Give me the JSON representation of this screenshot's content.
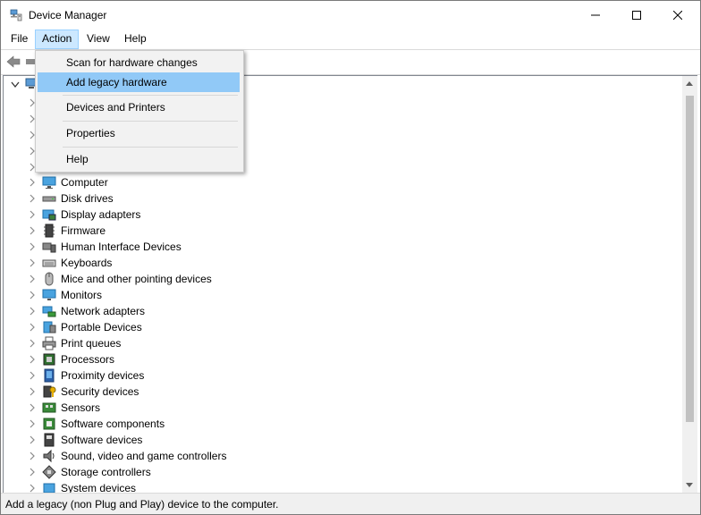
{
  "window": {
    "title": "Device Manager",
    "app_icon": "device-manager-icon"
  },
  "caption": {
    "minimize_icon": "minimize-icon",
    "maximize_icon": "maximize-icon",
    "close_icon": "close-icon"
  },
  "menu": {
    "file": "File",
    "action": "Action",
    "view": "View",
    "help": "Help"
  },
  "dropdown": {
    "items": [
      {
        "label": "Scan for hardware changes"
      },
      {
        "label": "Add legacy hardware",
        "highlighted": true
      },
      {
        "label": "Devices and Printers"
      },
      {
        "label": "Properties"
      },
      {
        "label": "Help"
      }
    ],
    "highlight_color": "#91c9f7"
  },
  "tree": {
    "items": [
      {
        "label": "Computer",
        "icon": "computer-icon"
      },
      {
        "label": "Disk drives",
        "icon": "disk-drive-icon"
      },
      {
        "label": "Display adapters",
        "icon": "display-adapter-icon"
      },
      {
        "label": "Firmware",
        "icon": "firmware-icon"
      },
      {
        "label": "Human Interface Devices",
        "icon": "hid-icon"
      },
      {
        "label": "Keyboards",
        "icon": "keyboard-icon"
      },
      {
        "label": "Mice and other pointing devices",
        "icon": "mouse-icon"
      },
      {
        "label": "Monitors",
        "icon": "monitor-icon"
      },
      {
        "label": "Network adapters",
        "icon": "network-adapter-icon"
      },
      {
        "label": "Portable Devices",
        "icon": "portable-device-icon"
      },
      {
        "label": "Print queues",
        "icon": "printer-icon"
      },
      {
        "label": "Processors",
        "icon": "processor-icon"
      },
      {
        "label": "Proximity devices",
        "icon": "proximity-icon"
      },
      {
        "label": "Security devices",
        "icon": "security-device-icon"
      },
      {
        "label": "Sensors",
        "icon": "sensor-icon"
      },
      {
        "label": "Software components",
        "icon": "software-component-icon"
      },
      {
        "label": "Software devices",
        "icon": "software-device-icon"
      },
      {
        "label": "Sound, video and game controllers",
        "icon": "speaker-icon"
      },
      {
        "label": "Storage controllers",
        "icon": "storage-controller-icon"
      },
      {
        "label": "System devices",
        "icon": "system-device-icon"
      }
    ]
  },
  "status": {
    "text": "Add a legacy (non Plug and Play) device to the computer."
  },
  "colors": {
    "accent": "#0078d7",
    "menu_active_bg": "#cce8ff"
  }
}
